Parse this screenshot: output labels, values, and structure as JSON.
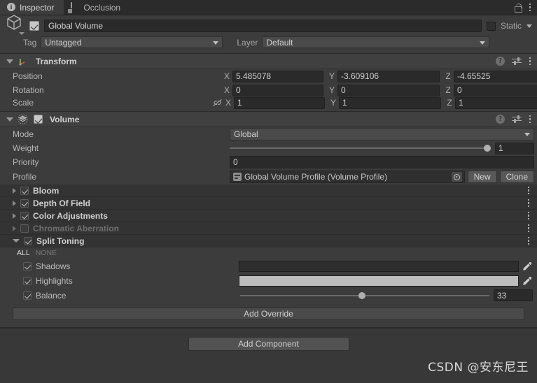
{
  "tabs": [
    {
      "label": "Inspector",
      "icon": "info-icon",
      "active": true
    },
    {
      "label": "Occlusion",
      "icon": "occlusion-icon",
      "active": false
    }
  ],
  "titlebar": {
    "lock_icon": "lock-icon",
    "menu_icon": "kebab-menu-icon"
  },
  "gameobject": {
    "name": "Global Volume",
    "enabled": true,
    "static_label": "Static",
    "static_checked": false,
    "tag_label": "Tag",
    "tag_value": "Untagged",
    "layer_label": "Layer",
    "layer_value": "Default"
  },
  "transform": {
    "title": "Transform",
    "rows": [
      {
        "label": "Position",
        "x": "5.485078",
        "y": "-3.609106",
        "z": "-4.65525"
      },
      {
        "label": "Rotation",
        "x": "0",
        "y": "0",
        "z": "0"
      },
      {
        "label": "Scale",
        "x": "1",
        "y": "1",
        "z": "1"
      }
    ],
    "axis_x": "X",
    "axis_y": "Y",
    "axis_z": "Z"
  },
  "volume": {
    "title": "Volume",
    "enabled": true,
    "mode_label": "Mode",
    "mode_value": "Global",
    "weight_label": "Weight",
    "weight_value": "1",
    "weight_percent": 100,
    "priority_label": "Priority",
    "priority_value": "0",
    "profile_label": "Profile",
    "profile_value": "Global Volume Profile (Volume Profile)",
    "new_button": "New",
    "clone_button": "Clone"
  },
  "overrides": [
    {
      "name": "Bloom",
      "checked": true,
      "expanded": false,
      "dim": false
    },
    {
      "name": "Depth Of Field",
      "checked": true,
      "expanded": false,
      "dim": false
    },
    {
      "name": "Color Adjustments",
      "checked": true,
      "expanded": false,
      "dim": false
    },
    {
      "name": "Chromatic Aberration",
      "checked": false,
      "expanded": false,
      "dim": true
    },
    {
      "name": "Split Toning",
      "checked": true,
      "expanded": true,
      "dim": false
    }
  ],
  "split_toning": {
    "all_label": "ALL",
    "none_label": "NONE",
    "shadows_label": "Shadows",
    "shadows_checked": true,
    "shadows_color": "#2e2e2e",
    "highlights_label": "Highlights",
    "highlights_checked": true,
    "highlights_color": "#bdbdbd",
    "balance_label": "Balance",
    "balance_checked": true,
    "balance_value": "33",
    "balance_percent": 49
  },
  "buttons": {
    "add_override": "Add Override",
    "add_component": "Add Component"
  },
  "watermark": "CSDN @安东尼王",
  "colors": {
    "panel": "#3c3c3c",
    "header": "#404040",
    "field": "#2a2a2a",
    "text": "#c4c4c4"
  }
}
